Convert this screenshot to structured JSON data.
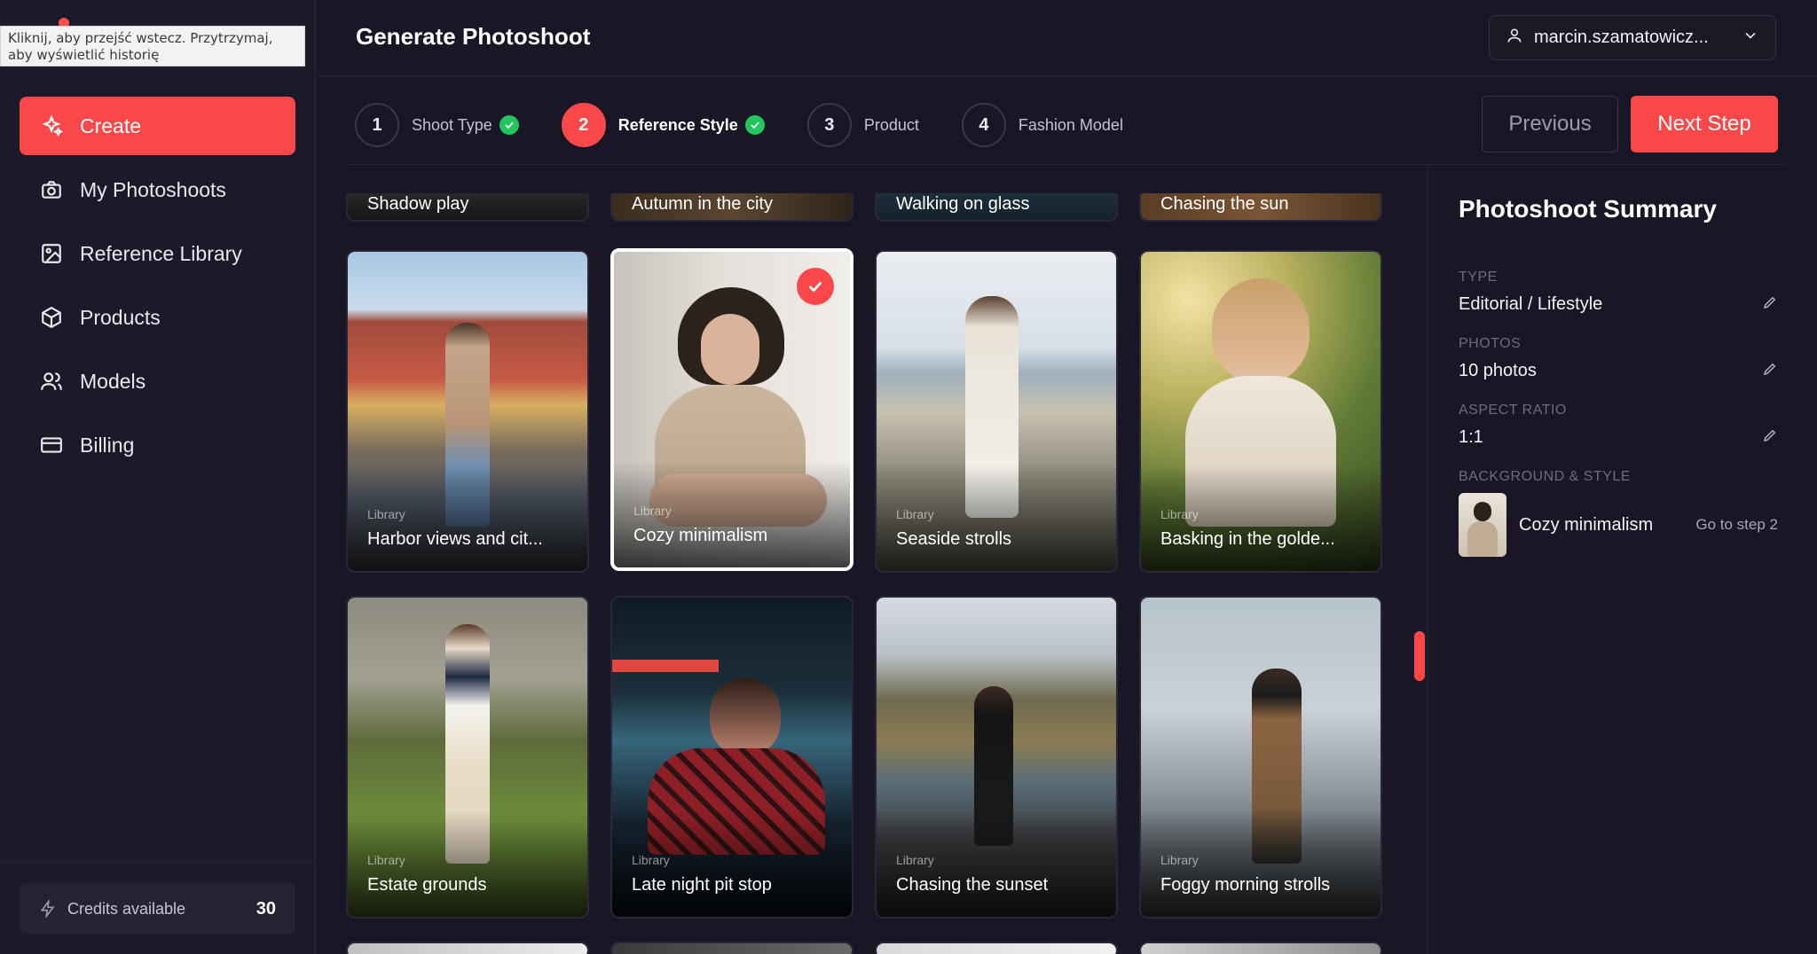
{
  "browser_tooltip": "Kliknij, aby przejść wstecz. Przytrzymaj, aby wyświetlić historię",
  "sidebar": {
    "items": [
      {
        "label": "Create",
        "icon": "sparkles-icon",
        "active": true
      },
      {
        "label": "My Photoshoots",
        "icon": "camera-icon",
        "active": false
      },
      {
        "label": "Reference Library",
        "icon": "image-icon",
        "active": false
      },
      {
        "label": "Products",
        "icon": "box-icon",
        "active": false
      },
      {
        "label": "Models",
        "icon": "users-icon",
        "active": false
      },
      {
        "label": "Billing",
        "icon": "credit-card-icon",
        "active": false
      }
    ],
    "credits_label": "Credits available",
    "credits_value": "30"
  },
  "header": {
    "title": "Generate Photoshoot",
    "user": "marcin.szamatowicz..."
  },
  "stepper": {
    "steps": [
      {
        "number": "1",
        "label": "Shoot Type",
        "done": true
      },
      {
        "number": "2",
        "label": "Reference Style",
        "done": true
      },
      {
        "number": "3",
        "label": "Product",
        "done": false
      },
      {
        "number": "4",
        "label": "Fashion Model",
        "done": false
      }
    ],
    "previous_label": "Previous",
    "next_label": "Next Step"
  },
  "grid": {
    "top_partial": [
      "Shadow play",
      "Autumn in the city",
      "Walking on glass",
      "Chasing the sun"
    ],
    "rows": [
      [
        {
          "tag": "Library",
          "title": "Harbor views and cit...",
          "selected": false
        },
        {
          "tag": "Library",
          "title": "Cozy minimalism",
          "selected": true
        },
        {
          "tag": "Library",
          "title": "Seaside strolls",
          "selected": false
        },
        {
          "tag": "Library",
          "title": "Basking in the golde...",
          "selected": false
        }
      ],
      [
        {
          "tag": "Library",
          "title": "Estate grounds",
          "selected": false
        },
        {
          "tag": "Library",
          "title": "Late night pit stop",
          "selected": false
        },
        {
          "tag": "Library",
          "title": "Chasing the sunset",
          "selected": false
        },
        {
          "tag": "Library",
          "title": "Foggy morning strolls",
          "selected": false
        }
      ]
    ]
  },
  "summary": {
    "title": "Photoshoot Summary",
    "type_key": "TYPE",
    "type_value": "Editorial / Lifestyle",
    "photos_key": "PHOTOS",
    "photos_value": "10 photos",
    "ratio_key": "ASPECT RATIO",
    "ratio_value": "1:1",
    "bg_key": "BACKGROUND & STYLE",
    "bg_value": "Cozy minimalism",
    "goto_label": "Go to step 2"
  },
  "colors": {
    "accent": "#f9474a",
    "background": "#191726",
    "success": "#22c55e"
  }
}
